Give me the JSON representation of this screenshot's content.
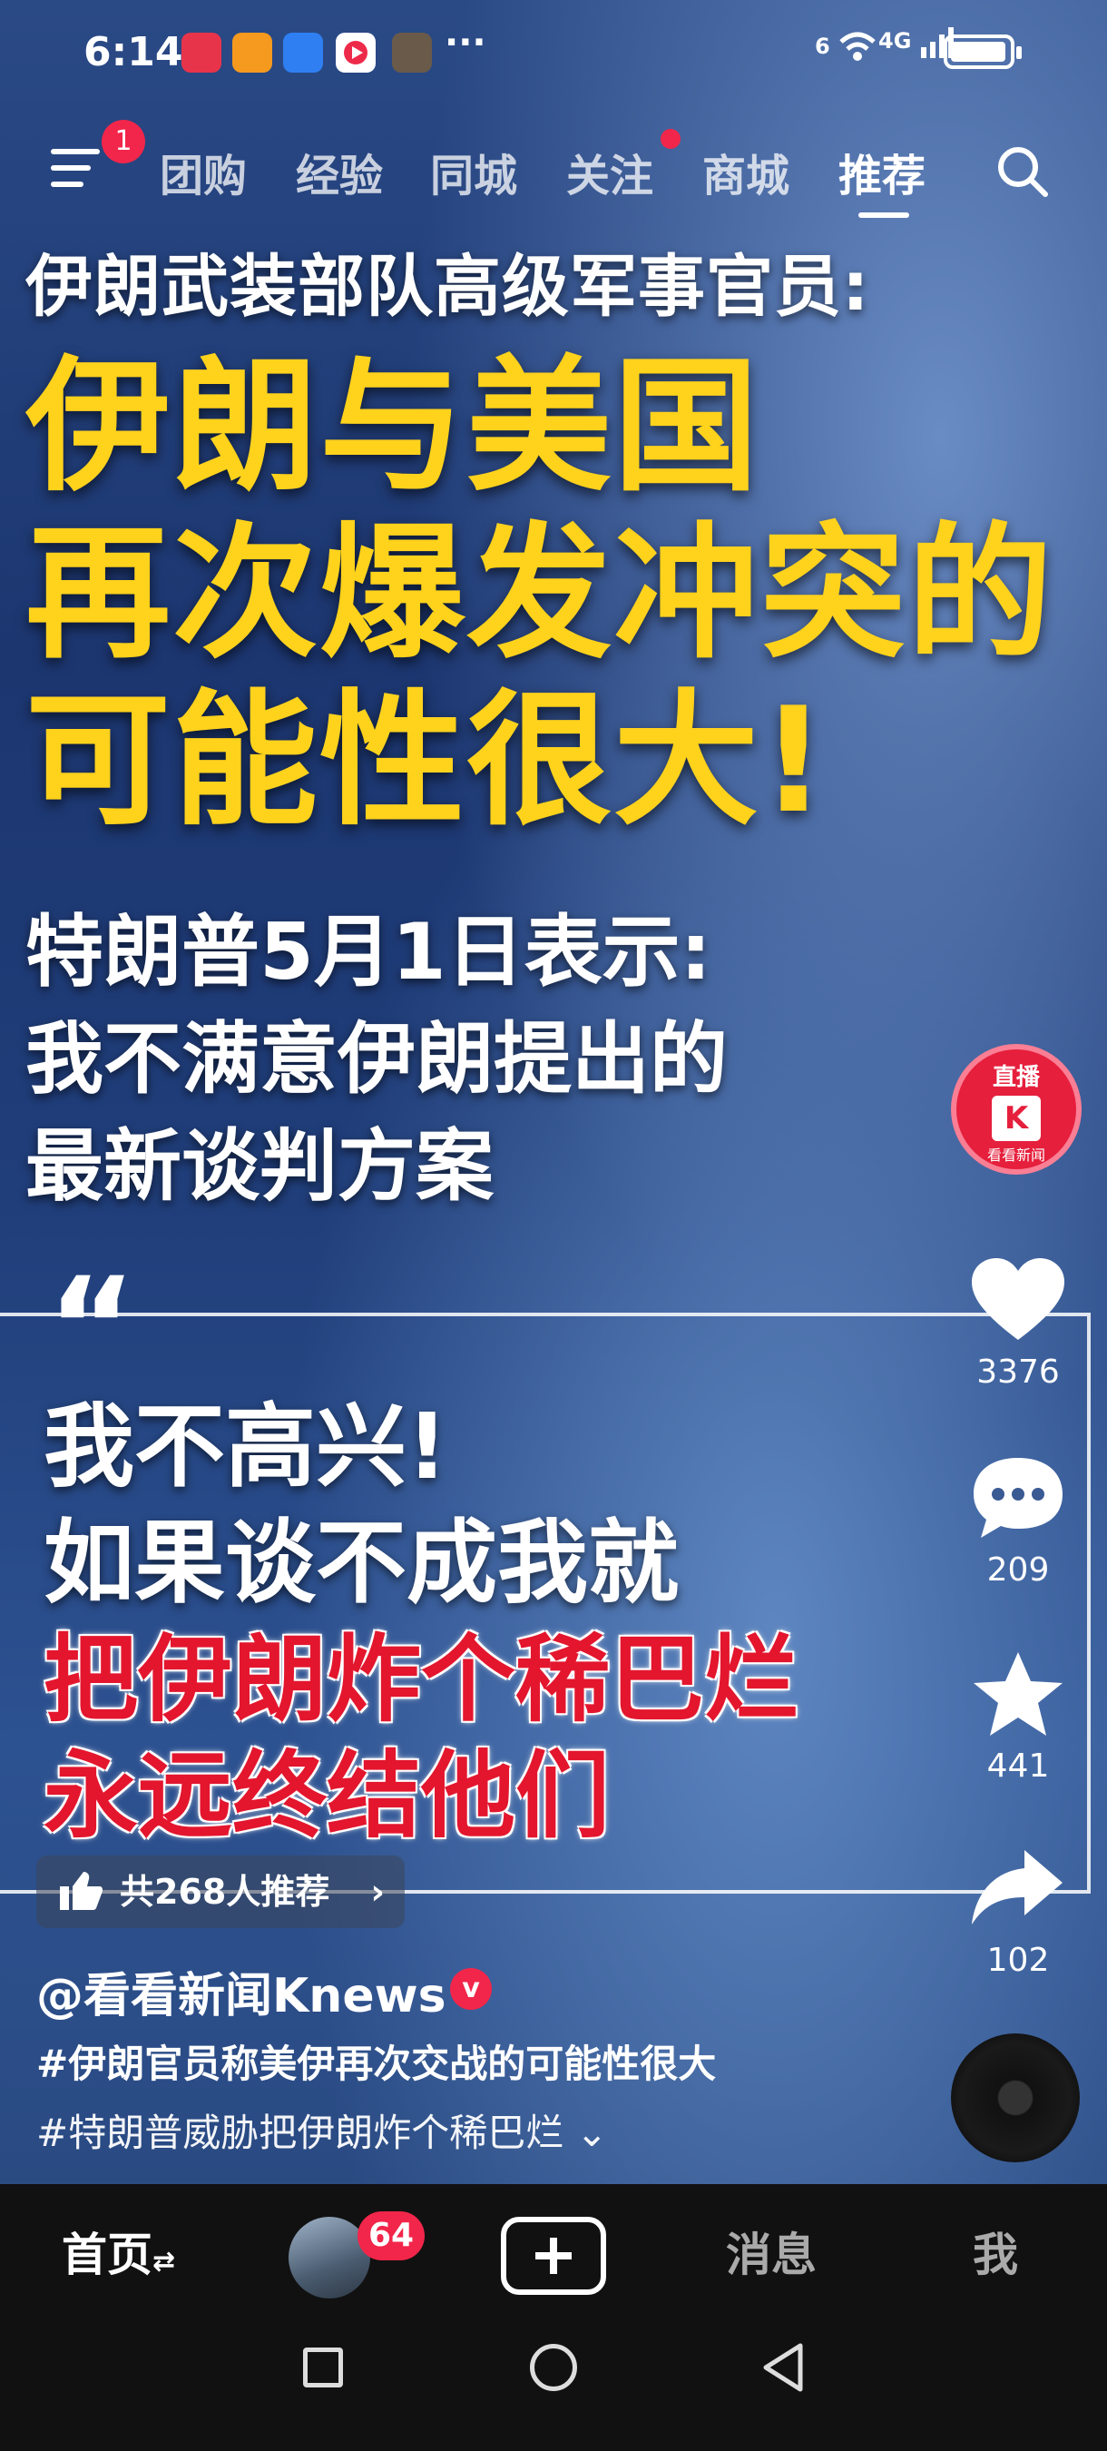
{
  "status_bar": {
    "time": "6:14",
    "more": "···",
    "network": "4G",
    "wifi_label": "6"
  },
  "top_nav": {
    "menu_badge": "1",
    "tabs": [
      {
        "label": "团购"
      },
      {
        "label": "经验"
      },
      {
        "label": "同城"
      },
      {
        "label": "关注"
      },
      {
        "label": "商城"
      },
      {
        "label": "推荐"
      }
    ],
    "active_tab": "推荐"
  },
  "video": {
    "headline": "伊朗武装部队高级军事官员:",
    "big_lines": [
      "伊朗与美国",
      "再次爆发冲突的",
      "可能性很大!"
    ],
    "sub_lines": [
      "特朗普5月1日表示:",
      "我不满意伊朗提出的",
      "最新谈判方案"
    ],
    "quote_mark": "“",
    "quote_white": [
      "我不高兴!",
      "如果谈不成我就"
    ],
    "quote_red": [
      "把伊朗炸个稀巴烂",
      "永远终结他们"
    ]
  },
  "live": {
    "label": "直播",
    "logo": "K",
    "channel": "看看新闻"
  },
  "actions": {
    "likes": "3376",
    "comments": "209",
    "favorites": "441",
    "shares": "102"
  },
  "recommend": {
    "text": "共268人推荐",
    "chevron": "›"
  },
  "author": {
    "name": "@看看新闻Knews",
    "verified": "v"
  },
  "tags": [
    "#伊朗官员称美伊再次交战的可能性很大",
    "#特朗普威胁把伊朗炸个稀巴烂"
  ],
  "tags_expand": "⌄",
  "bottom_nav": {
    "home": "首页",
    "home_switch": "⇄",
    "avatar_badge": "64",
    "messages": "消息",
    "me": "我"
  },
  "colors": {
    "accent_yellow": "#ffd21c",
    "accent_red": "#e3162e",
    "badge_red": "#f2264a"
  }
}
